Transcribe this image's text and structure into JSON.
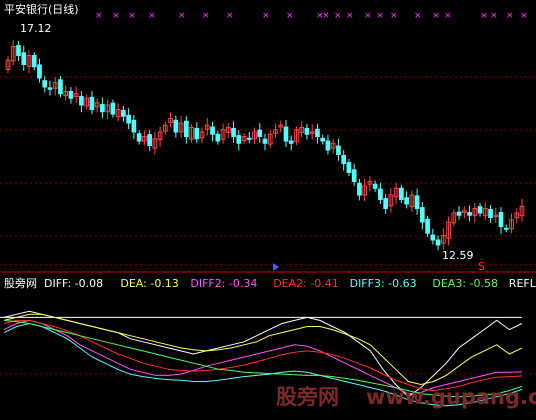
{
  "upper_panel": {
    "title": "平安银行(日线)",
    "max_label": "17.12",
    "min_label": "12.59",
    "signal_marker": "S"
  },
  "lower_panel": {
    "indicator_name": "股旁网",
    "legend": [
      {
        "key": "DIFF",
        "text": "DIFF: -0.08",
        "color": "#ffffff"
      },
      {
        "key": "DEA",
        "text": "DEA: -0.13",
        "color": "#ffff55"
      },
      {
        "key": "DIFF2",
        "text": "DIFF2: -0.34",
        "color": "#ff55ff"
      },
      {
        "key": "DEA2",
        "text": "DEA2: -0.41",
        "color": "#ff3333"
      },
      {
        "key": "DIFF3",
        "text": "DIFF3: -0.63",
        "color": "#55ffff"
      },
      {
        "key": "DEA3",
        "text": "DEA3: -0.58",
        "color": "#55ff55"
      },
      {
        "key": "REFLINE",
        "text": "REFLINE",
        "color": "#ffffff"
      }
    ]
  },
  "watermark": {
    "cn": "股旁网",
    "url": "www.gupang.com"
  },
  "colors": {
    "up_candle": "#ff4444",
    "down_candle": "#55ffff",
    "grid": "#8b0000",
    "cross_marks": "#ff33ff",
    "title_text": "#ffffff"
  },
  "chart_data": [
    {
      "type": "candlestick",
      "title": "平安银行(日线)",
      "max_price": 17.12,
      "min_price": 12.59,
      "ylim": [
        12.3,
        17.5
      ],
      "grid": true,
      "closes": [
        16.7,
        17.0,
        16.8,
        16.6,
        16.8,
        16.55,
        16.3,
        16.1,
        16.05,
        16.2,
        15.95,
        16.0,
        15.85,
        15.95,
        15.7,
        15.85,
        15.6,
        15.75,
        15.55,
        15.7,
        15.5,
        15.6,
        15.45,
        15.3,
        15.1,
        14.9,
        15.0,
        14.8,
        14.95,
        15.1,
        15.25,
        15.4,
        15.1,
        15.3,
        15.0,
        15.2,
        14.95,
        15.1,
        15.25,
        15.05,
        14.9,
        15.15,
        15.2,
        15.0,
        14.85,
        15.0,
        14.95,
        15.1,
        15.0,
        14.85,
        15.05,
        15.15,
        15.25,
        14.9,
        14.85,
        15.15,
        15.2,
        15.05,
        15.1,
        15.0,
        14.9,
        14.7,
        14.85,
        14.6,
        14.4,
        14.2,
        14.0,
        13.7,
        13.9,
        14.0,
        13.85,
        13.6,
        13.4,
        13.7,
        13.85,
        13.6,
        13.5,
        13.7,
        13.4,
        13.1,
        12.85,
        12.7,
        12.59,
        12.8,
        13.1,
        13.3,
        13.25,
        13.35,
        13.25,
        13.4,
        13.3,
        13.4,
        13.2,
        13.25,
        13.0,
        12.95,
        13.15,
        13.3,
        13.45
      ],
      "price_range": [
        12.59,
        17.12
      ]
    },
    {
      "type": "line",
      "title": "股旁网",
      "series": [
        {
          "name": "DIFF",
          "values": [
            0.55,
            0.6,
            0.65,
            0.6,
            0.55,
            0.5,
            0.45,
            0.4,
            0.35,
            0.3,
            0.2,
            0.15,
            0.1,
            0.05,
            0.0,
            -0.05,
            0.0,
            0.05,
            0.1,
            0.15,
            0.25,
            0.35,
            0.45,
            0.5,
            0.55,
            0.5,
            0.4,
            0.3,
            0.15,
            0.0,
            -0.3,
            -0.55,
            -0.75,
            -0.6,
            -0.4,
            -0.2,
            0.05,
            0.2,
            0.35,
            0.5,
            0.35,
            0.45
          ]
        },
        {
          "name": "DEA",
          "values": [
            0.5,
            0.55,
            0.6,
            0.6,
            0.55,
            0.5,
            0.45,
            0.4,
            0.35,
            0.3,
            0.25,
            0.2,
            0.15,
            0.1,
            0.05,
            0.02,
            0.0,
            0.02,
            0.05,
            0.1,
            0.15,
            0.25,
            0.3,
            0.35,
            0.4,
            0.4,
            0.35,
            0.28,
            0.2,
            0.1,
            -0.1,
            -0.3,
            -0.5,
            -0.55,
            -0.5,
            -0.4,
            -0.25,
            -0.1,
            0.0,
            0.1,
            -0.05,
            0.05
          ]
        },
        {
          "name": "DIFF2",
          "values": [
            0.35,
            0.45,
            0.5,
            0.45,
            0.35,
            0.25,
            0.1,
            0.0,
            -0.1,
            -0.2,
            -0.3,
            -0.35,
            -0.4,
            -0.4,
            -0.38,
            -0.32,
            -0.25,
            -0.2,
            -0.15,
            -0.1,
            -0.05,
            0.0,
            0.05,
            0.1,
            0.08,
            0.0,
            -0.1,
            -0.2,
            -0.3,
            -0.4,
            -0.5,
            -0.6,
            -0.7,
            -0.68,
            -0.6,
            -0.55,
            -0.5,
            -0.45,
            -0.4,
            -0.35,
            -0.35,
            -0.34
          ]
        },
        {
          "name": "DEA2",
          "values": [
            0.45,
            0.5,
            0.5,
            0.45,
            0.4,
            0.33,
            0.25,
            0.15,
            0.05,
            -0.05,
            -0.12,
            -0.2,
            -0.25,
            -0.3,
            -0.32,
            -0.33,
            -0.32,
            -0.3,
            -0.27,
            -0.23,
            -0.18,
            -0.12,
            -0.06,
            -0.02,
            0.0,
            -0.02,
            -0.06,
            -0.12,
            -0.2,
            -0.28,
            -0.38,
            -0.48,
            -0.55,
            -0.62,
            -0.65,
            -0.62,
            -0.58,
            -0.52,
            -0.47,
            -0.43,
            -0.42,
            -0.41
          ]
        },
        {
          "name": "DIFF3",
          "values": [
            0.3,
            0.4,
            0.45,
            0.4,
            0.3,
            0.2,
            0.05,
            -0.1,
            -0.2,
            -0.3,
            -0.38,
            -0.42,
            -0.45,
            -0.47,
            -0.48,
            -0.5,
            -0.5,
            -0.48,
            -0.45,
            -0.42,
            -0.4,
            -0.38,
            -0.35,
            -0.33,
            -0.35,
            -0.4,
            -0.45,
            -0.5,
            -0.55,
            -0.6,
            -0.65,
            -0.72,
            -0.8,
            -0.85,
            -0.88,
            -0.9,
            -0.88,
            -0.85,
            -0.8,
            -0.75,
            -0.7,
            -0.63
          ]
        },
        {
          "name": "DEA3",
          "values": [
            0.5,
            0.48,
            0.45,
            0.4,
            0.35,
            0.3,
            0.25,
            0.2,
            0.15,
            0.1,
            0.05,
            0.0,
            -0.05,
            -0.1,
            -0.15,
            -0.2,
            -0.25,
            -0.3,
            -0.32,
            -0.35,
            -0.36,
            -0.37,
            -0.38,
            -0.39,
            -0.4,
            -0.4,
            -0.42,
            -0.45,
            -0.48,
            -0.52,
            -0.56,
            -0.6,
            -0.65,
            -0.7,
            -0.72,
            -0.74,
            -0.75,
            -0.74,
            -0.72,
            -0.7,
            -0.65,
            -0.58
          ]
        }
      ],
      "refline": 0.55,
      "ylim": [
        -1.0,
        0.9
      ]
    }
  ]
}
